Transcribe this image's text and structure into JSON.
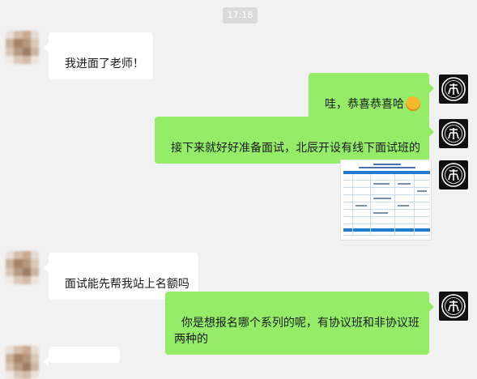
{
  "timestamp": "17:18",
  "messages": [
    {
      "side": "left",
      "text": "我进面了老师！"
    },
    {
      "side": "right",
      "text": "哇，恭喜恭喜哈",
      "emoji": "grinning-face-emoji"
    },
    {
      "side": "right",
      "text": "接下来就好好准备面试，北辰开设有线下面试班的"
    },
    {
      "side": "right",
      "type": "image"
    },
    {
      "side": "left",
      "text": "面试能先帮我站上名额吗"
    },
    {
      "side": "right",
      "text": "你是想报名哪个系列的呢，有协议班和非协议班两种的"
    }
  ],
  "colors": {
    "background": "#f1f1f1",
    "bubble_self": "#95ec69",
    "bubble_other": "#ffffff",
    "timestamp_bg": "#dadada"
  },
  "icons": {
    "contact_avatar": "blurred-avatar",
    "self_avatar": "black-white-logo-avatar"
  }
}
